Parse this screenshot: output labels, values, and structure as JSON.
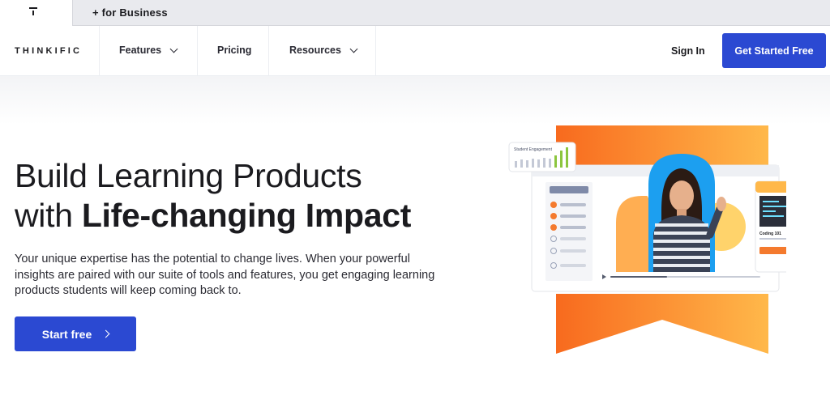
{
  "topbar": {
    "business_link": "+ for Business"
  },
  "nav": {
    "brand": "THINKIFIC",
    "items": [
      {
        "label": "Features",
        "has_dropdown": true
      },
      {
        "label": "Pricing",
        "has_dropdown": false
      },
      {
        "label": "Resources",
        "has_dropdown": true
      }
    ],
    "sign_in": "Sign In",
    "cta": "Get Started Free"
  },
  "hero": {
    "headline_line1": "Build Learning Products",
    "headline_line2_prefix": "with ",
    "headline_line2_bold": "Life-changing Impact",
    "lead": "Your unique expertise has the potential to change lives. When your powerful insights are paired with our suite of tools and features, you get engaging learning products students will keep coming back to.",
    "start_button": "Start free",
    "illustration": {
      "engagement_label": "Student Engagement",
      "course_card_title": "Coding 101"
    }
  },
  "colors": {
    "primary": "#2b49d2",
    "orange": "#f97a26",
    "orange_light": "#ffb347",
    "topbar_bg": "#e9eaee"
  }
}
